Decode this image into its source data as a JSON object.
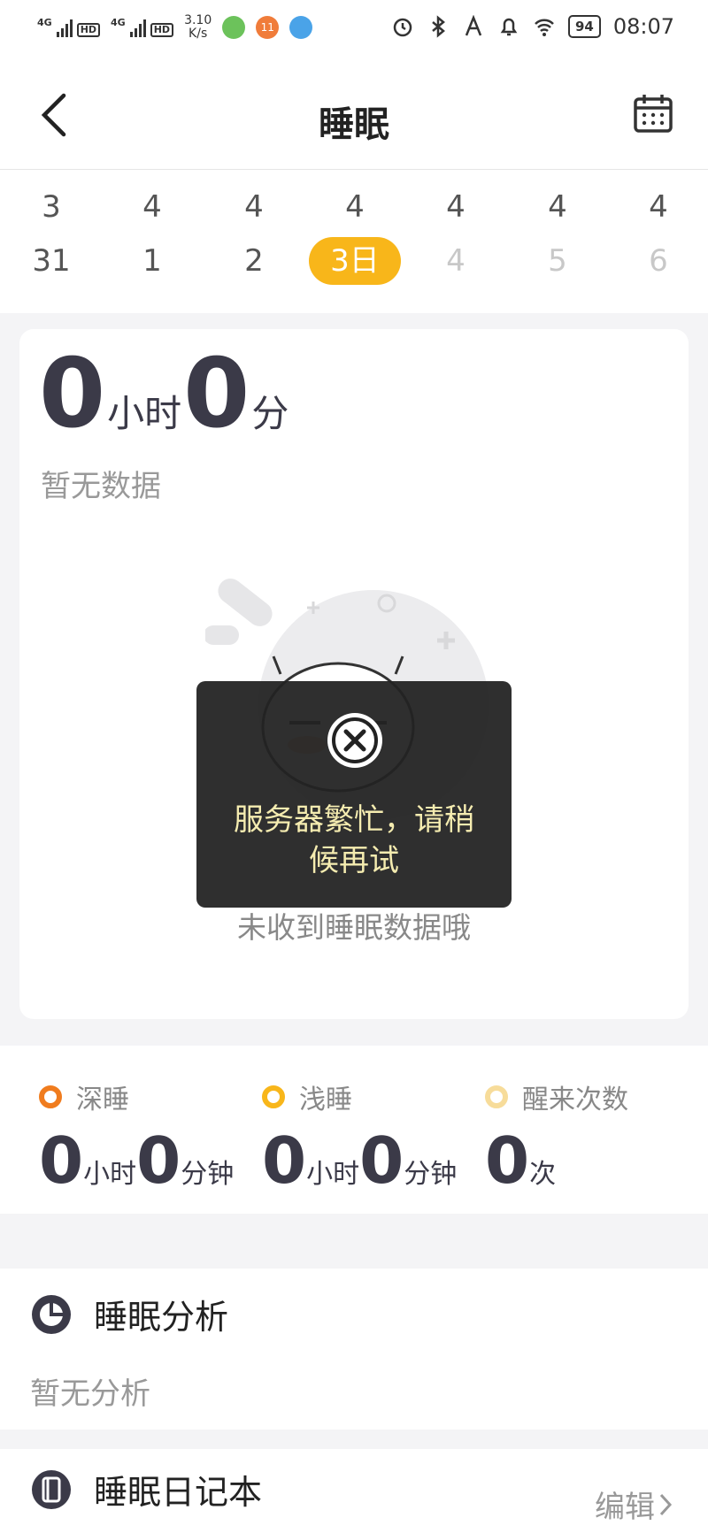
{
  "status_bar": {
    "net1": "4G",
    "net2": "4G",
    "hd": "HD",
    "speed_top": "3.10",
    "speed_bottom": "K/s",
    "badge": "11",
    "battery": "94",
    "time": "08:07"
  },
  "nav": {
    "title": "睡眠"
  },
  "dates": [
    {
      "month": "3",
      "day": "31",
      "state": "past"
    },
    {
      "month": "4",
      "day": "1",
      "state": "past"
    },
    {
      "month": "4",
      "day": "2",
      "state": "past"
    },
    {
      "month": "4",
      "day": "3日",
      "state": "active"
    },
    {
      "month": "4",
      "day": "4",
      "state": "future"
    },
    {
      "month": "4",
      "day": "5",
      "state": "future"
    },
    {
      "month": "4",
      "day": "6",
      "state": "future"
    }
  ],
  "summary": {
    "hours": "0",
    "hours_unit": "小时",
    "minutes": "0",
    "minutes_unit": "分",
    "no_data": "暂无数据",
    "empty_text": "未收到睡眠数据哦"
  },
  "toast": {
    "message": "服务器繁忙，请稍候再试"
  },
  "stats": {
    "deep": {
      "label": "深睡",
      "hours": "0",
      "hours_unit": "小时",
      "minutes": "0",
      "minutes_unit": "分钟",
      "color": "#f07c1e"
    },
    "light": {
      "label": "浅睡",
      "hours": "0",
      "hours_unit": "小时",
      "minutes": "0",
      "minutes_unit": "分钟",
      "color": "#f8b61a"
    },
    "wake": {
      "label": "醒来次数",
      "count": "0",
      "count_unit": "次",
      "color": "#f7dc9a"
    }
  },
  "analysis": {
    "title": "睡眠分析",
    "subtitle": "暂无分析"
  },
  "diary": {
    "title": "睡眠日记本",
    "edit": "编辑"
  },
  "colors": {
    "accent": "#f8b61a",
    "text_dark": "#3b3a48"
  }
}
